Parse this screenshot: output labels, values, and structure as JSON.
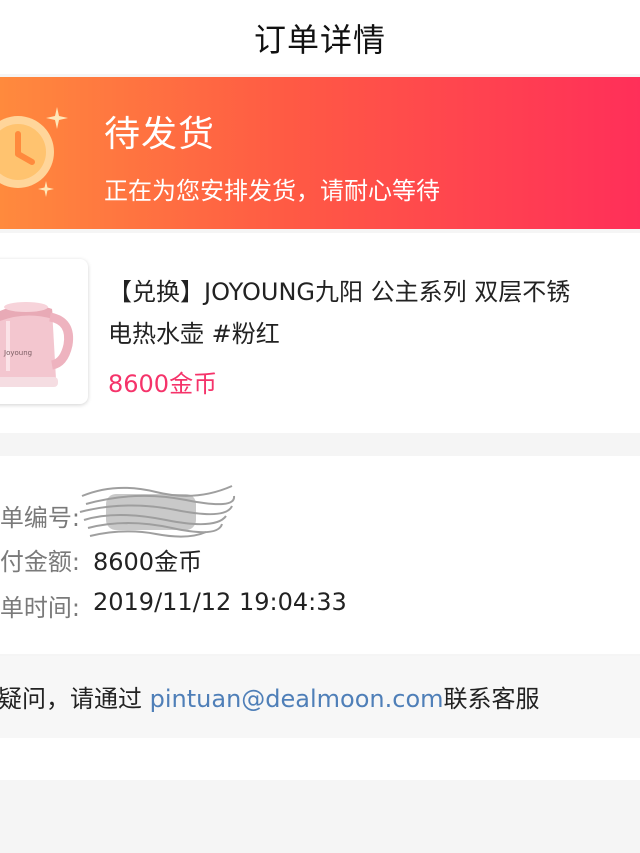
{
  "nav": {
    "title": "订单详情"
  },
  "status": {
    "icon": "clock-icon",
    "title": "待发货",
    "subtitle": "正在为您安排发货，请耐心等待",
    "gradient_start": "#ff8a3d",
    "gradient_end": "#ff2f59"
  },
  "product": {
    "image": "pink-electric-kettle",
    "name_line1": "【兑换】JOYOUNG九阳 公主系列 双层不锈",
    "name_line2": "电热水壶 #粉红",
    "price": "8600金币",
    "price_color": "#f5336a"
  },
  "order_info": {
    "rows": [
      {
        "label": "单编号:",
        "value": ""
      },
      {
        "label": "付金额:",
        "value": "8600金币"
      },
      {
        "label": "单时间:",
        "value": "2019/11/12 19:04:33"
      }
    ]
  },
  "contact": {
    "prefix": "有疑问，请通过 ",
    "email": "pintuan@dealmoon.com",
    "suffix": "联系客服",
    "email_color": "#4f7fb8"
  }
}
